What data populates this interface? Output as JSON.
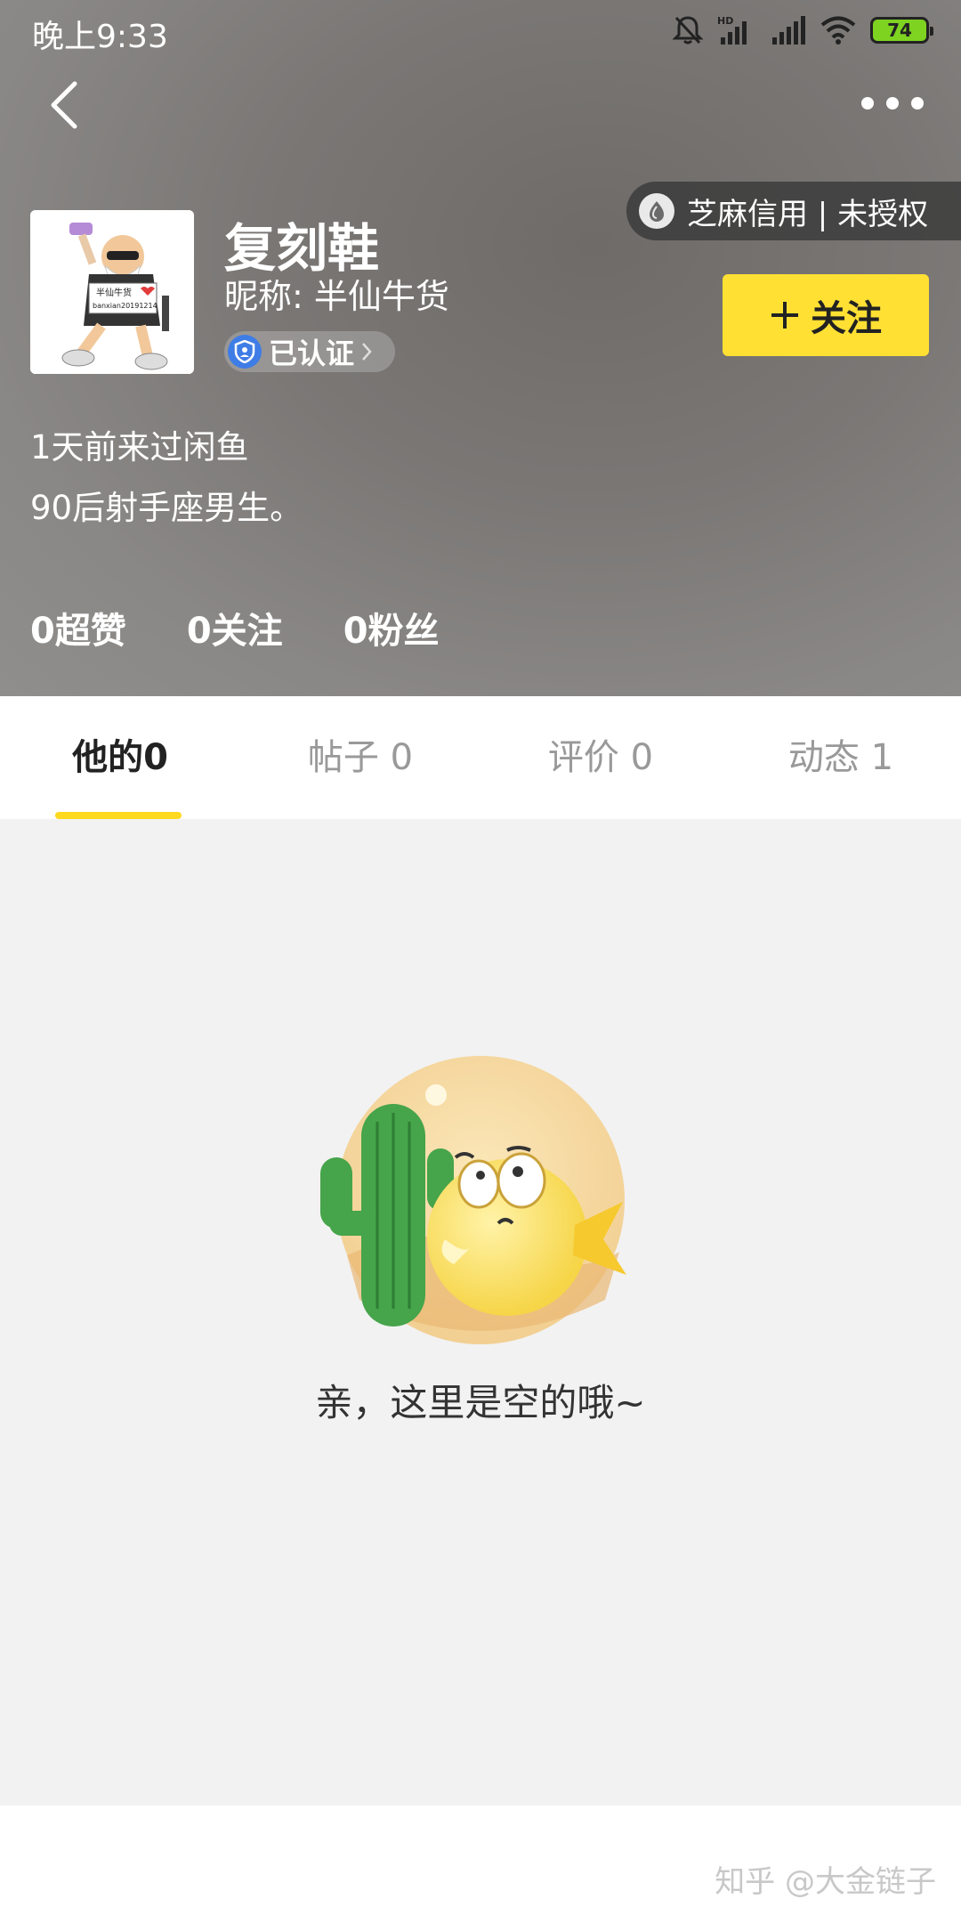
{
  "status_bar": {
    "time": "晚上9:33",
    "battery": "74",
    "network_label": "HD"
  },
  "nav": {
    "back_icon": "chevron-left-icon",
    "more_icon": "more-dots-icon"
  },
  "credit": {
    "label": "芝麻信用 | 未授权"
  },
  "profile": {
    "name": "复刻鞋",
    "nickname": "昵称: 半仙牛货",
    "verified_label": "已认证",
    "follow_label": "关注",
    "last_visit": "1天前来过闲鱼",
    "bio": "90后射手座男生。",
    "avatar_caption_1": "半仙牛货",
    "avatar_caption_2": "banxian20191214"
  },
  "stats": [
    {
      "label": "0超赞"
    },
    {
      "label": "0关注"
    },
    {
      "label": "0粉丝"
    }
  ],
  "tabs": [
    {
      "label": "他的0"
    },
    {
      "label": "帖子 0"
    },
    {
      "label": "评价 0"
    },
    {
      "label": "动态 1"
    }
  ],
  "empty_state": {
    "message": "亲，这里是空的哦~"
  },
  "watermark": "知乎 @大金链子",
  "colors": {
    "accent_yellow": "#ffe033",
    "tab_indicator": "#ffd91f",
    "verified_blue": "#3f7de6",
    "battery_green": "#7ed321"
  }
}
